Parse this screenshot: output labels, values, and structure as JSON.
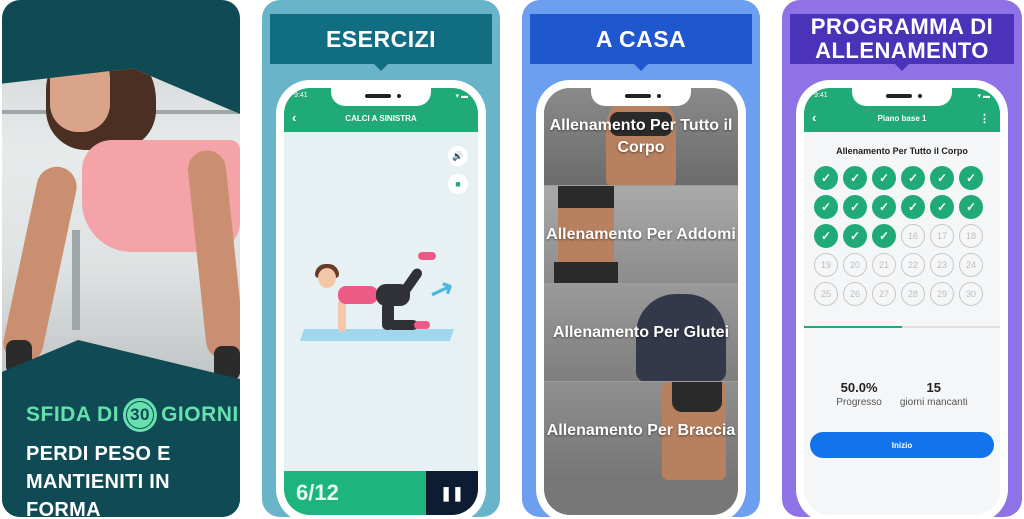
{
  "panels": {
    "intro": {
      "challenge_prefix": "SFIDA DI",
      "challenge_days": "30",
      "challenge_suffix": "GIORNI",
      "tagline_line1": "PERDI PESO E",
      "tagline_line2": "MANTIENITI IN FORMA"
    },
    "exercises": {
      "banner": "ESERCIZI",
      "status_time": "9:41",
      "status_icons": "▾ ▬",
      "back_icon": "‹",
      "screen_title": "CALCI A SINISTRA",
      "sound_icon": "🔊",
      "video_icon": "■",
      "counter": "6/12",
      "pause_icon": "❚❚"
    },
    "home": {
      "banner": "A CASA",
      "workouts": [
        {
          "title": "Allenamento Per Tutto il Corpo"
        },
        {
          "title": "Allenamento Per Addomi"
        },
        {
          "title": "Allenamento Per Glutei"
        },
        {
          "title": "Allenamento Per Braccia"
        }
      ]
    },
    "program": {
      "banner": "PROGRAMMA DI ALLENAMENTO",
      "status_time": "9:41",
      "status_icons": "▾ ▬",
      "back_icon": "‹",
      "screen_title": "Piano base 1",
      "more_icon": "⋮",
      "plan_title": "Allenamento Per Tutto il Corpo",
      "total_days": 30,
      "completed_days": 15,
      "check_icon": "✓",
      "progress_percent": 50.0,
      "progress_value": "50.0%",
      "progress_label": "Progresso",
      "days_left_value": "15",
      "days_left_label": "giorni mancanti",
      "start_button": "Inizio"
    }
  },
  "colors": {
    "green": "#1faa77",
    "mint": "#66e0ad",
    "teal_dark": "#0f4a55",
    "esercizi_banner": "#116d82",
    "casa_banner": "#1f57cf",
    "programma_banner": "#4a33b8",
    "start_blue": "#1273ea"
  }
}
